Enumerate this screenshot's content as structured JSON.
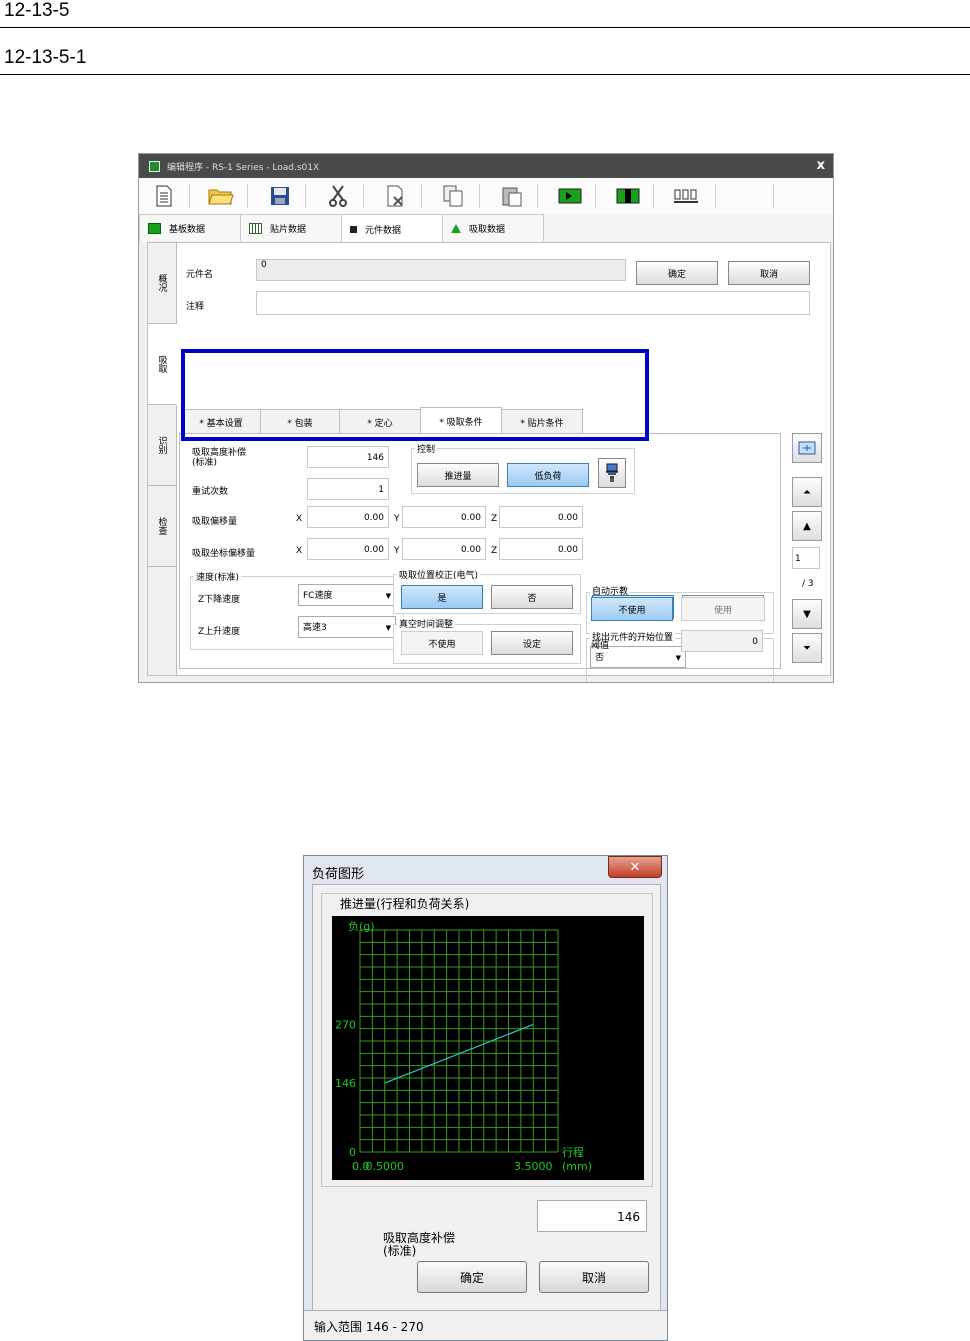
{
  "doc": {
    "section": "12-13-5",
    "subsection": "12-13-5-1"
  },
  "window": {
    "title": "编辑程序 - RS-1 Series - Load.s01X",
    "close": "x",
    "toolbar_icons": [
      "new-file-icon",
      "open-folder-icon",
      "save-icon",
      "cut-icon",
      "delete-icon",
      "copy-icon",
      "paste-icon",
      "move-right-icon",
      "move-center-icon",
      "component-icon"
    ],
    "main_tabs": [
      {
        "label": "基板数据",
        "icon": "board-icon",
        "color": "#1aa01a"
      },
      {
        "label": "贴片数据",
        "icon": "grid-icon",
        "color": "#2a6a2a"
      },
      {
        "label": "元件数据",
        "icon": "chip-icon",
        "color": "#222222"
      },
      {
        "label": "吸取数据",
        "icon": "arrow-up-icon",
        "color": "#1aa01a"
      }
    ],
    "side_tabs": [
      "概况",
      "吸取",
      "识别",
      "检查"
    ],
    "component_label": "元件名",
    "component_value": "0",
    "comment_label": "注释",
    "ok": "确定",
    "cancel": "取消",
    "sub_tabs": [
      "* 基本设置",
      "* 包装",
      "* 定心",
      "* 吸取条件",
      "* 贴片条件"
    ],
    "height_comp_label": "吸取高度补偿\n(标准)",
    "height_comp_value": "146",
    "retry_label": "重试次数",
    "retry_value": "1",
    "control_label": "控制",
    "thrust_btn": "推进量",
    "low_load_btn": "低负荷",
    "offset_label": "吸取偏移量",
    "offset_x": "0.00",
    "offset_y": "0.00",
    "offset_z": "0.00",
    "coord_offset_label": "吸取坐标偏移量",
    "x": "X",
    "y": "Y",
    "z": "Z",
    "coord_x": "0.00",
    "coord_y": "0.00",
    "coord_z": "0.00",
    "speed_group": "速度(标准)",
    "z_down_label": "Z下降速度",
    "z_down_value": "FC速度",
    "z_up_label": "Z上升速度",
    "z_up_value": "高速3",
    "auto_teach_label": "自动示教",
    "yes": "是",
    "no": "否",
    "pos_correct_label": "吸取位置校正(电气)",
    "vacuum_label": "真空时间调整",
    "not_use": "不使用",
    "setting": "设定",
    "use": "使用",
    "find_start_label": "找出元件的开始位置",
    "find_start_value": "否",
    "threshold_label": "阈值",
    "threshold_value": "0",
    "page_value": "1",
    "page_total": "/ 3"
  },
  "dialog": {
    "title": "负荷图形",
    "close": "✕",
    "group_title": "推进量(行程和负荷关系)",
    "y_label": "负(g)",
    "x_label_1": "行程",
    "x_label_2": "(mm)",
    "field_label": "吸取高度补偿\n(标准)",
    "field_value": "146",
    "ok": "确定",
    "cancel": "取消",
    "status": "输入范围 146 - 270"
  },
  "chart_data": {
    "type": "line",
    "title": "推进量(行程和负荷关系)",
    "ylabel": "负(g)",
    "xlabel": "行程 (mm)",
    "y_ticks": [
      "0",
      "146",
      "270"
    ],
    "x_ticks": [
      "0.0",
      "0.5000",
      "3.5000"
    ],
    "series": [
      {
        "x": [
          0.5,
          3.5
        ],
        "y": [
          146,
          270
        ]
      }
    ],
    "grid": true,
    "line_color": "#22cccc",
    "grid_color": "#3a9a1a"
  }
}
